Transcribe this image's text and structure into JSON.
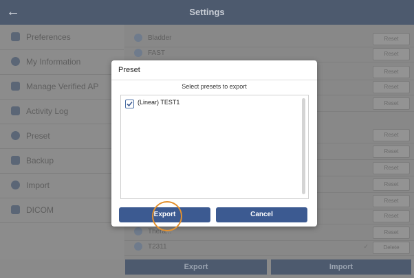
{
  "header": {
    "title": "Settings",
    "back_icon": "arrow-left-icon"
  },
  "sidebar": {
    "items": [
      {
        "label": "Preferences",
        "icon": "gear-icon"
      },
      {
        "label": "My Information",
        "icon": "user-icon"
      },
      {
        "label": "Manage Verified AP",
        "icon": "shield-icon"
      },
      {
        "label": "Activity Log",
        "icon": "log-icon"
      },
      {
        "label": "Preset",
        "icon": "preset-icon"
      },
      {
        "label": "Backup",
        "icon": "backup-icon"
      },
      {
        "label": "Import",
        "icon": "import-icon"
      },
      {
        "label": "DICOM",
        "icon": "dicom-icon"
      }
    ]
  },
  "content": {
    "rows": [
      {
        "label": "Bladder",
        "action": "Reset"
      },
      {
        "label": "FAST",
        "action": "Reset"
      },
      {
        "label": "",
        "action": "Reset"
      },
      {
        "label": "",
        "action": "Reset"
      },
      {
        "label": "",
        "action": "Reset"
      },
      {
        "label": "",
        "action": ""
      },
      {
        "label": "",
        "action": "Reset"
      },
      {
        "label": "",
        "action": "Reset"
      },
      {
        "label": "",
        "action": "Reset"
      },
      {
        "label": "",
        "action": "Reset"
      },
      {
        "label": "",
        "action": "Reset"
      },
      {
        "label": "",
        "action": "Reset"
      },
      {
        "label": "",
        "action": "Reset"
      },
      {
        "label": "Thera...",
        "action": "Reset"
      },
      {
        "label": "T2311",
        "action": "Delete"
      }
    ]
  },
  "bottom": {
    "export_label": "Export",
    "import_label": "Import"
  },
  "modal": {
    "title": "Preset",
    "subtitle": "Select presets to export",
    "items": [
      {
        "label": "(Linear) TEST1",
        "checked": true
      }
    ],
    "export_label": "Export",
    "cancel_label": "Cancel"
  }
}
